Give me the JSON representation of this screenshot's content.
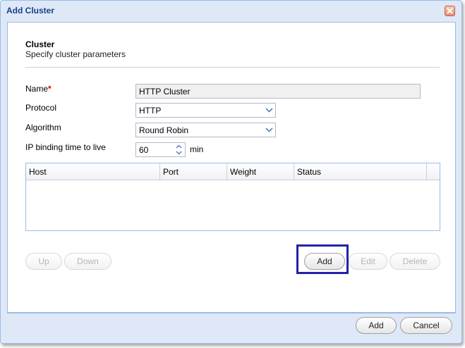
{
  "window": {
    "title": "Add Cluster"
  },
  "section": {
    "title": "Cluster",
    "subtitle": "Specify cluster parameters"
  },
  "form": {
    "name": {
      "label": "Name",
      "required_mark": "*",
      "value": "HTTP Cluster"
    },
    "protocol": {
      "label": "Protocol",
      "value": "HTTP"
    },
    "algorithm": {
      "label": "Algorithm",
      "value": "Round Robin"
    },
    "ip_binding": {
      "label": "IP binding time to live",
      "value": "60",
      "unit": "min"
    }
  },
  "grid": {
    "columns": [
      "Host",
      "Port",
      "Weight",
      "Status"
    ],
    "rows": []
  },
  "grid_buttons": {
    "up": "Up",
    "down": "Down",
    "add": "Add",
    "edit": "Edit",
    "delete": "Delete"
  },
  "footer": {
    "add": "Add",
    "cancel": "Cancel"
  },
  "colors": {
    "title": "#15428b",
    "dialog_bg": "#dfe8f6",
    "border": "#99bbe8",
    "highlight": "#2222aa"
  }
}
